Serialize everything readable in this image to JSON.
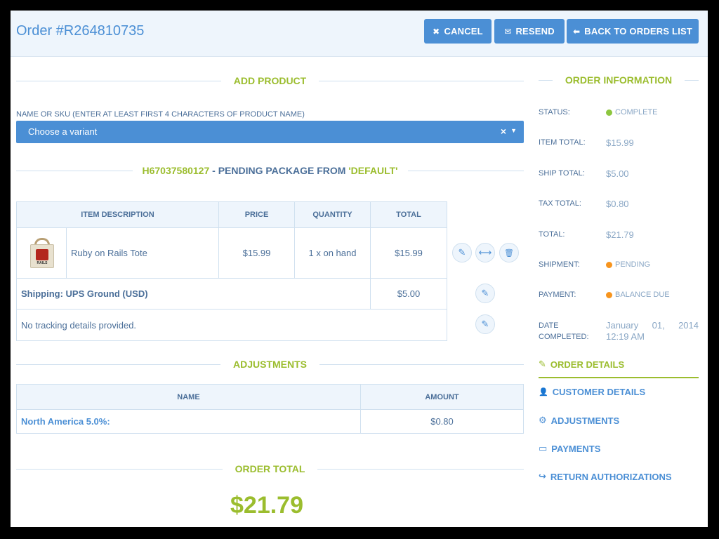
{
  "header": {
    "title": "Order #R264810735",
    "cancel_label": "CANCEL",
    "resend_label": "RESEND",
    "back_label": "BACK TO ORDERS LIST"
  },
  "add_product": {
    "title": "ADD PRODUCT",
    "field_label": "NAME OR SKU (ENTER AT LEAST FIRST 4 CHARACTERS OF PRODUCT NAME)",
    "placeholder": "Choose a variant",
    "clear_glyph": "×",
    "dropdown_glyph": "▼"
  },
  "package": {
    "id": "H67037580127",
    "text": " - PENDING PACKAGE FROM ",
    "stock": "'DEFAULT'"
  },
  "items_table": {
    "headers": [
      "ITEM DESCRIPTION",
      "PRICE",
      "QUANTITY",
      "TOTAL"
    ],
    "row": {
      "description": "Ruby on Rails Tote",
      "price": "$15.99",
      "quantity": "1 x on hand",
      "total": "$15.99",
      "image_logo_text": "RAILS"
    },
    "shipping_label": "Shipping: UPS Ground (USD)",
    "shipping_total": "$5.00",
    "tracking": "No tracking details provided."
  },
  "adjustments": {
    "title": "ADJUSTMENTS",
    "headers": [
      "NAME",
      "AMOUNT"
    ],
    "row": {
      "name": "North America 5.0%:",
      "amount": "$0.80"
    }
  },
  "order_total": {
    "title": "ORDER TOTAL",
    "amount": "$21.79"
  },
  "order_info": {
    "title": "ORDER INFORMATION",
    "status_label": "STATUS:",
    "status_value": "COMPLETE",
    "item_total_label": "ITEM TOTAL:",
    "item_total_value": "$15.99",
    "ship_total_label": "SHIP TOTAL:",
    "ship_total_value": "$5.00",
    "tax_total_label": "TAX TOTAL:",
    "tax_total_value": "$0.80",
    "total_label": "TOTAL:",
    "total_value": "$21.79",
    "shipment_label": "SHIPMENT:",
    "shipment_value": "PENDING",
    "payment_label": "PAYMENT:",
    "payment_value": "BALANCE DUE",
    "date_label_1": "DATE",
    "date_label_2": "COMPLETED:",
    "date_value_1": "January",
    "date_value_2": "01,",
    "date_value_3": "2014",
    "date_value_4": "12:19 AM",
    "colors": {
      "complete": "#8dc63f",
      "pending": "#f7941d"
    }
  },
  "nav": {
    "order_details": "ORDER DETAILS",
    "customer_details": "CUSTOMER DETAILS",
    "adjustments": "ADJUSTMENTS",
    "payments": "PAYMENTS",
    "return_authorizations": "RETURN AUTHORIZATIONS"
  },
  "icons": {
    "cancel": "✖",
    "resend": "✉",
    "back": "⬅",
    "edit": "✎",
    "split": "⟷",
    "delete": "🗑",
    "order_details": "✎",
    "customer": "👤",
    "adjustments": "⚙",
    "payments": "▭",
    "return": "↪"
  },
  "colors": {
    "primary": "#4b8fd5",
    "accent": "#9bbd2e",
    "text": "#4b6f99"
  }
}
